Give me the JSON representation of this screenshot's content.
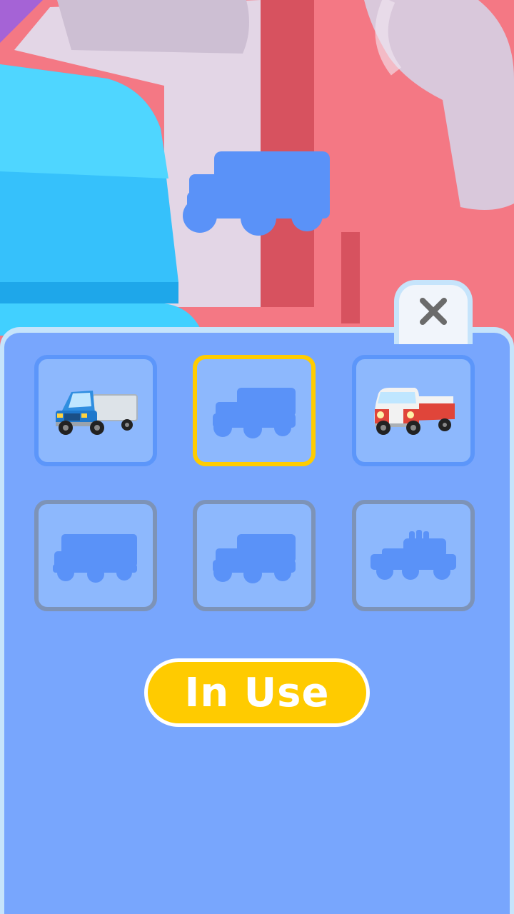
{
  "colors": {
    "sky_wall": "#f47884",
    "panel": "#78a6fd",
    "panel_border": "#c6e4fb",
    "slot_fill": "#8db8fd",
    "slot_border_owned": "#5c96fa",
    "slot_border_locked": "#7d93b7",
    "slot_border_selected": "#ffcc00",
    "silhouette": "#5a92f8",
    "button": "#ffcb00"
  },
  "close_button": {
    "icon": "close-x-icon"
  },
  "vehicles": [
    {
      "id": "blue-box-truck",
      "state": "owned",
      "icon": "blue-box-truck-icon"
    },
    {
      "id": "mystery-dump-truck",
      "state": "selected-locked",
      "icon": "dump-truck-silhouette-icon"
    },
    {
      "id": "red-camper-van",
      "state": "owned",
      "icon": "red-camper-van-icon"
    },
    {
      "id": "mystery-cargo-truck",
      "state": "locked",
      "icon": "cargo-truck-silhouette-icon"
    },
    {
      "id": "mystery-dump-truck-2",
      "state": "locked",
      "icon": "dump-truck-silhouette-icon"
    },
    {
      "id": "mystery-jeep",
      "state": "locked",
      "icon": "jeep-silhouette-icon"
    }
  ],
  "action_button": {
    "label": "In Use"
  }
}
